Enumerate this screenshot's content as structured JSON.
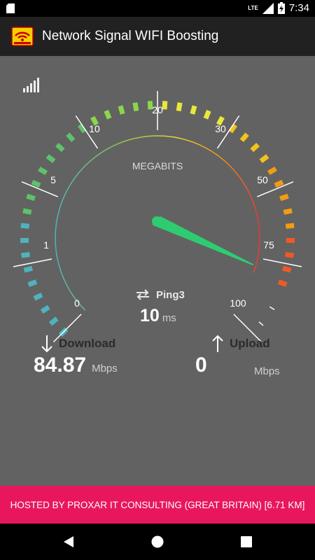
{
  "status_bar": {
    "network": "LTE",
    "time": "7:34"
  },
  "app_bar": {
    "title": "Network Signal WIFI Boosting"
  },
  "gauge": {
    "unit_label": "MEGABITS",
    "scale_labels": [
      "0",
      "1",
      "5",
      "10",
      "20",
      "30",
      "50",
      "75",
      "100"
    ],
    "needle_value_label": "75"
  },
  "ping": {
    "label": "Ping3",
    "value": "10",
    "unit": "ms"
  },
  "download": {
    "label": "Download",
    "value": "84.87",
    "unit": "Mbps"
  },
  "upload": {
    "label": "Upload",
    "value": "0",
    "unit": "Mbps"
  },
  "footer": {
    "text": "HOSTED BY PROXAR IT CONSULTING (GREAT BRITAIN) [6.71 KM]"
  },
  "colors": {
    "footer_bg": "#e8175d",
    "needle": "#2ecc71",
    "app_bar": "#212121"
  }
}
